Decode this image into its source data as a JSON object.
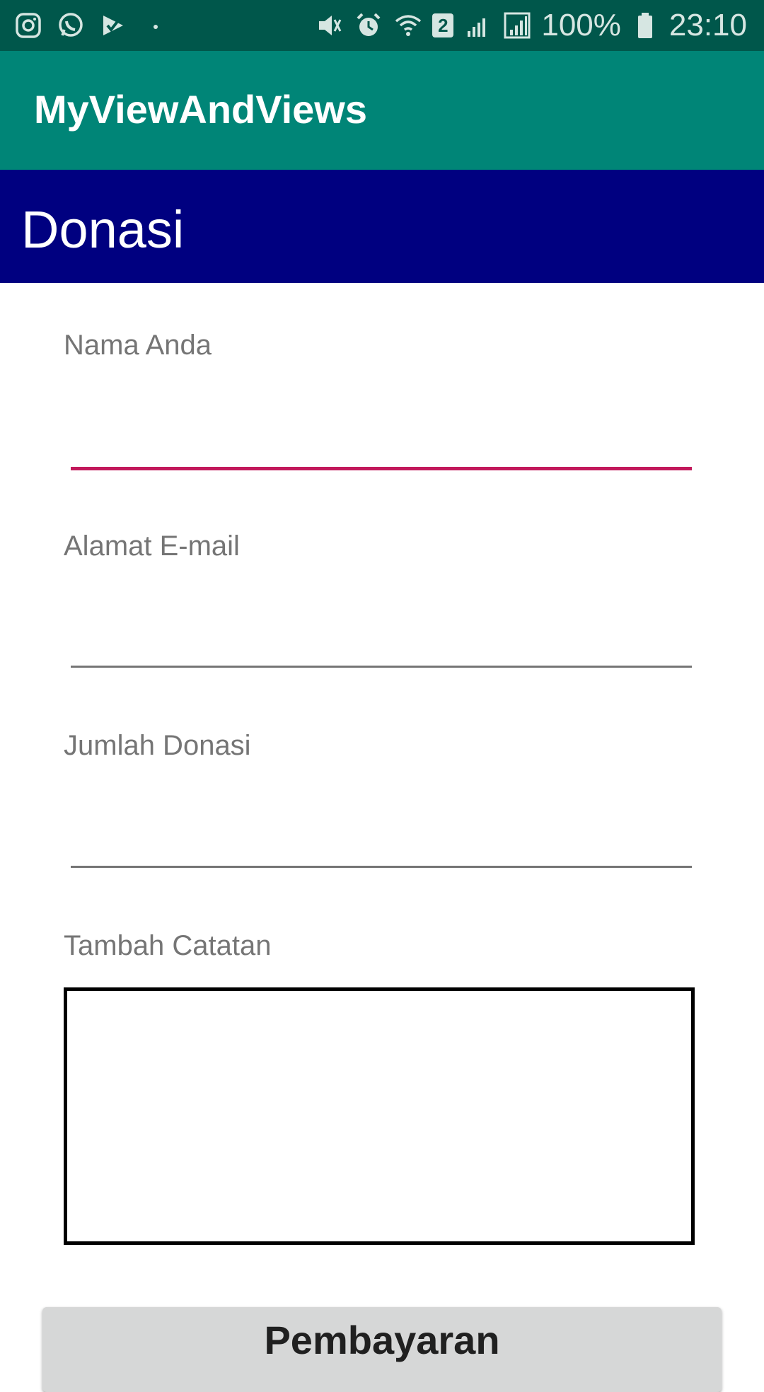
{
  "status_bar": {
    "left_icons": [
      "instagram-icon",
      "whatsapp-icon",
      "play-check-icon",
      "dot-icon"
    ],
    "right_icons": [
      "vibrate-mute-icon",
      "alarm-icon",
      "wifi-icon",
      "sim2-badge",
      "signal-weak-icon",
      "signal-icon",
      "battery-icon"
    ],
    "sim_badge": "2",
    "battery_percent": "100%",
    "time": "23:10"
  },
  "app_bar": {
    "title": "MyViewAndViews"
  },
  "header": {
    "title": "Donasi"
  },
  "form": {
    "name_label": "Nama Anda",
    "name_value": "",
    "email_label": "Alamat E-mail",
    "email_value": "",
    "amount_label": "Jumlah Donasi",
    "amount_value": "",
    "notes_label": "Tambah Catatan",
    "notes_value": ""
  },
  "button": {
    "label": "Pembayaran"
  },
  "colors": {
    "status_bar": "#00574b",
    "app_bar": "#008577",
    "header_band": "#000080",
    "focus_underline": "#c2185b"
  }
}
